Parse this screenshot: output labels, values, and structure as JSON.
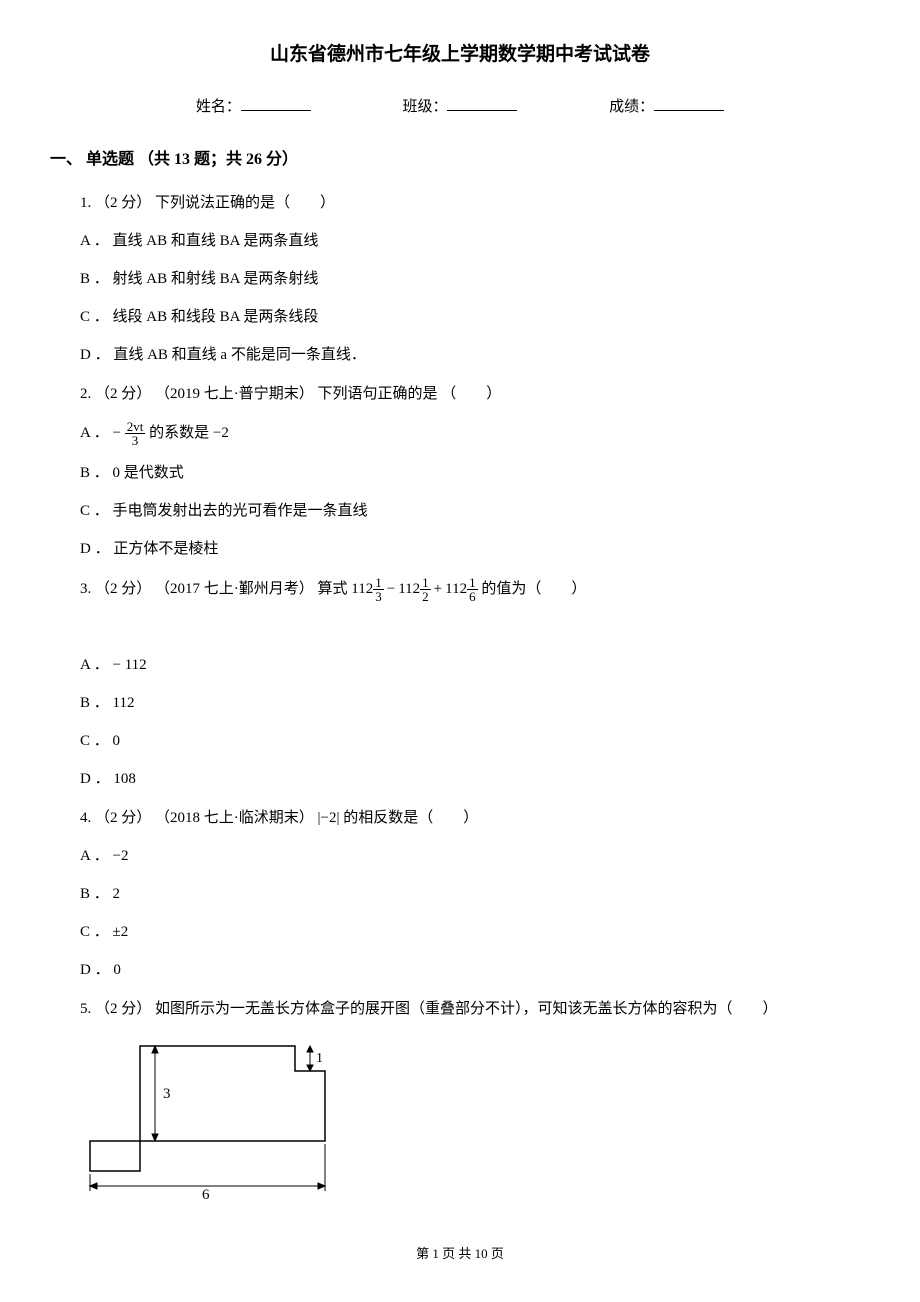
{
  "title": "山东省德州市七年级上学期数学期中考试试卷",
  "header": {
    "name_label": "姓名：",
    "class_label": "班级：",
    "score_label": "成绩："
  },
  "section1": {
    "header": "一、 单选题 （共 13 题；共 26 分）"
  },
  "q1": {
    "stem_prefix": "1. ",
    "points": "（2 分）",
    "stem": " 下列说法正确的是（　　）",
    "a": "A ． 直线 AB 和直线 BA 是两条直线",
    "b": "B ． 射线 AB 和射线 BA 是两条射线",
    "c": "C ． 线段 AB 和线段 BA 是两条线段",
    "d": "D ． 直线 AB 和直线 a 不能是同一条直线．"
  },
  "q2": {
    "stem_prefix": "2. ",
    "points": "（2 分）",
    "source": "（2019 七上·普宁期末）",
    "stem": "下列语句正确的是",
    "a_pre": "A ．",
    "a_frac_num": "2vt",
    "a_frac_den": "3",
    "a_post": " 的系数是 ",
    "a_val": "−2",
    "b": "B ． 0 是代数式",
    "c": "C ． 手电筒发射出去的光可看作是一条直线",
    "d": "D ． 正方体不是棱柱"
  },
  "q3": {
    "stem_prefix": "3. ",
    "points": "（2 分）",
    "source": "（2017 七上·鄞州月考）",
    "stem_pre": "算式 ",
    "w1": "112",
    "n1": "1",
    "d1": "3",
    "op1": "−",
    "w2": "112",
    "n2": "1",
    "d2": "2",
    "op2": "+",
    "w3": "112",
    "n3": "1",
    "d3": "6",
    "stem_post": " 的值为（　　）",
    "a": "A ． − 112",
    "b": "B ． 112",
    "c": "C ． 0",
    "d": "D ． 108"
  },
  "q4": {
    "stem_prefix": "4. ",
    "points": "（2 分）",
    "source": "（2018 七上·临沭期末）",
    "stem_val": "|−2|",
    "stem_post": " 的相反数是（　　）",
    "a_pre": "A ．",
    "a_val": "−2",
    "b_pre": "B ．",
    "b_val": "2",
    "c_pre": "C ．",
    "c_val": "±2",
    "d_pre": "D ．",
    "d_val": "0"
  },
  "q5": {
    "stem_prefix": "5. ",
    "points": "（2 分）",
    "stem": " 如图所示为一无盖长方体盒子的展开图（重叠部分不计），可知该无盖长方体的容积为（　　）",
    "diagram": {
      "dim1": "1",
      "dim3": "3",
      "dim6": "6"
    }
  },
  "footer": "第 1 页 共 10 页"
}
